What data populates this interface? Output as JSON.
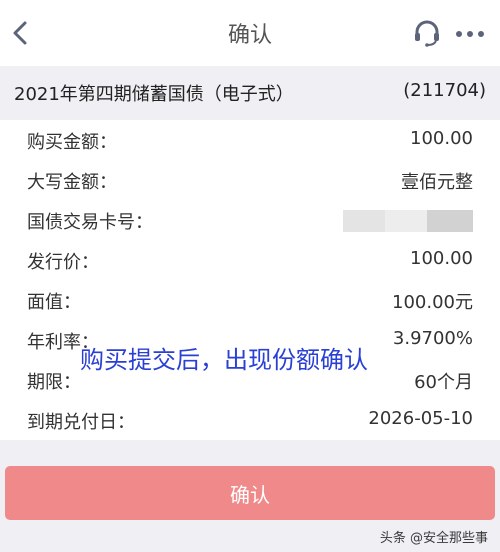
{
  "nav": {
    "title": "确认",
    "back_icon": "chevron-left-icon",
    "headset_icon": "headset-icon",
    "more_icon": "more-dots-icon",
    "icon_color": "#5b6478"
  },
  "product": {
    "name": "2021年第四期储蓄国债（电子式）",
    "code": "(211704)"
  },
  "details": [
    {
      "label": "购买金额：",
      "value": "100.00"
    },
    {
      "label": "大写金额：",
      "value": "壹佰元整"
    },
    {
      "label": "国债交易卡号：",
      "value": ""
    },
    {
      "label": "发行价：",
      "value": "100.00"
    },
    {
      "label": "面值：",
      "value": "100.00元"
    },
    {
      "label": "年利率：",
      "value": "3.9700%"
    },
    {
      "label": "期限：",
      "value": "60个月"
    },
    {
      "label": "到期兑付日：",
      "value": "2026-05-10"
    }
  ],
  "annotation": "购买提交后，出现份额确认",
  "confirm_button": "确认",
  "watermark": "头条 @安全那些事",
  "colors": {
    "background": "#efeff4",
    "button": "#f08a8a",
    "annotation": "#2a3fd4"
  }
}
